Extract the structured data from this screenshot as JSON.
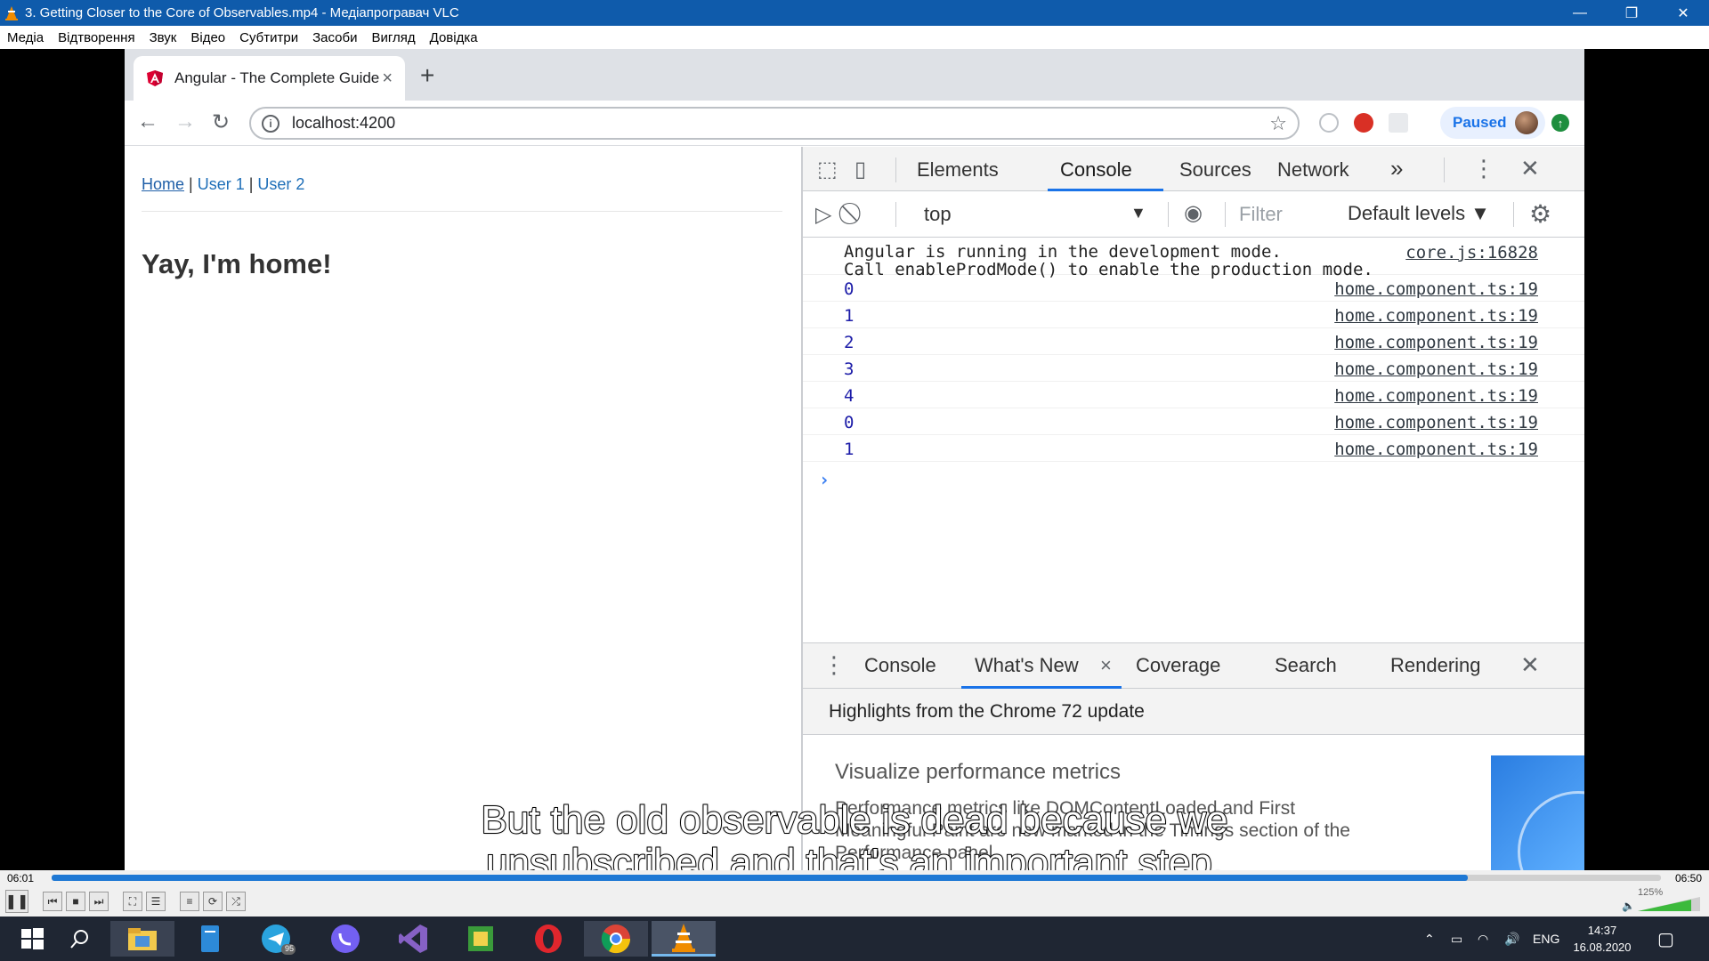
{
  "window": {
    "title": "3. Getting Closer to the Core of Observables.mp4 - Медіапрогравач VLC",
    "controls": [
      "—",
      "❐",
      "✕"
    ]
  },
  "menu": [
    "Медіа",
    "Відтворення",
    "Звук",
    "Відео",
    "Субтитри",
    "Засоби",
    "Вигляд",
    "Довідка"
  ],
  "browser": {
    "tab_title": "Angular - The Complete Guide",
    "tab_close": "×",
    "new_tab": "+",
    "url": "localhost:4200",
    "paused_label": "Paused"
  },
  "page": {
    "nav_home": "Home",
    "nav_sep1": " | ",
    "nav_user1": "User 1",
    "nav_sep2": " | ",
    "nav_user2": "User 2",
    "heading": "Yay, I'm home!"
  },
  "devtools": {
    "tabs": [
      "Elements",
      "Console",
      "Sources",
      "Network"
    ],
    "more": "»",
    "context": "top",
    "filter_placeholder": "Filter",
    "levels": "Default levels ▼",
    "console_messages": [
      {
        "text": "Angular is running in the development mode.\nCall enableProdMode() to enable the production mode.",
        "source": "core.js:16828"
      },
      {
        "text": "0",
        "source": "home.component.ts:19"
      },
      {
        "text": "1",
        "source": "home.component.ts:19"
      },
      {
        "text": "2",
        "source": "home.component.ts:19"
      },
      {
        "text": "3",
        "source": "home.component.ts:19"
      },
      {
        "text": "4",
        "source": "home.component.ts:19"
      },
      {
        "text": "0",
        "source": "home.component.ts:19"
      },
      {
        "text": "1",
        "source": "home.component.ts:19"
      }
    ],
    "prompt": "›",
    "drawer_tabs": [
      "Console",
      "What's New",
      "Coverage",
      "Search",
      "Rendering"
    ],
    "drawer_tab_close": "×",
    "highlights": "Highlights from the Chrome 72 update",
    "whatsnew_title": "Visualize performance metrics",
    "whatsnew_desc": "Performance metrics like DOMContentLoaded and First Meaningful Paint are now marked in the Timings section of the Performance panel."
  },
  "subtitle": {
    "line1": "But the old observable is dead because we",
    "line2": "unsubscribed and that's an important step."
  },
  "player": {
    "time_elapsed": "06:01",
    "time_total": "06:50",
    "progress": 0.88,
    "volume_label": "125%"
  },
  "taskbar": {
    "lang": "ENG",
    "time": "14:37",
    "date": "16.08.2020",
    "telegram_badge": "95"
  },
  "colors": {
    "vlc_title": "#0f5bab",
    "chrome_blue": "#1a73e8",
    "console_number": "#1c1ca8",
    "taskbar": "#1f2633"
  }
}
